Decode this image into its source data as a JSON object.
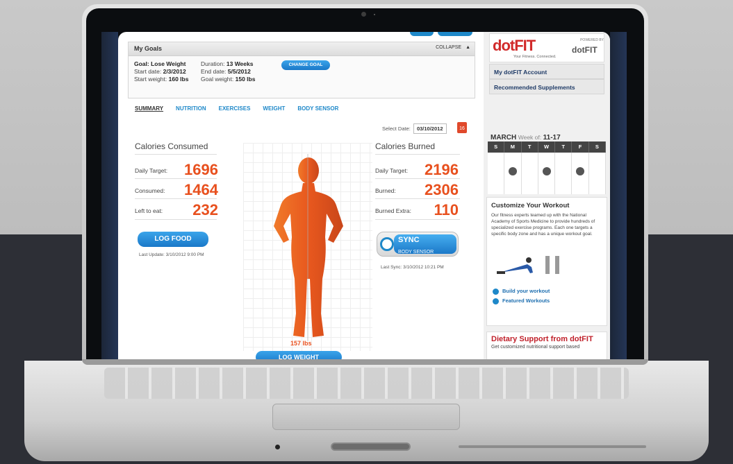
{
  "goals": {
    "title": "My Goals",
    "collapse": "COLLAPSE",
    "goal": "Goal: Lose Weight",
    "start_date_label": "Start date:",
    "start_date": "2/3/2012",
    "start_weight_label": "Start weight:",
    "start_weight": "160 lbs",
    "duration_label": "Duration:",
    "duration": "13 Weeks",
    "end_date_label": "End date:",
    "end_date": "5/5/2012",
    "goal_weight_label": "Goal weight:",
    "goal_weight": "150 lbs",
    "change_goal": "CHANGE GOAL"
  },
  "tabs": [
    "SUMMARY",
    "NUTRITION",
    "EXERCISES",
    "WEIGHT",
    "BODY SENSOR"
  ],
  "date_select": {
    "label": "Select Date:",
    "value": "03/10/2012",
    "icon": "calendar-icon"
  },
  "consumed": {
    "title": "Calories Consumed",
    "daily_target_label": "Daily Target:",
    "daily_target": "1696",
    "consumed_label": "Consumed:",
    "consumed": "1464",
    "left_label": "Left to eat:",
    "left": "232",
    "button": "LOG FOOD",
    "last_update": "Last Update: 3/10/2012 9:00 PM"
  },
  "burned": {
    "title": "Calories Burned",
    "daily_target_label": "Daily Target:",
    "daily_target": "2196",
    "burned_label": "Burned:",
    "burned": "2306",
    "extra_label": "Burned Extra:",
    "extra": "110",
    "sync_title": "SYNC",
    "sync_sub": "BODY SENSOR",
    "last_sync": "Last Sync: 3/10/2012 10:21 PM"
  },
  "body": {
    "weight": "157 lbs",
    "button": "LOG WEIGHT"
  },
  "side": {
    "logo_main": "dotFIT",
    "logo_tag": "Your Fitness. Connected.",
    "powered": "POWERED BY",
    "logo_small": "dotFIT",
    "links": [
      "My dotFIT Account",
      "Recommended Supplements"
    ],
    "month": "MARCH",
    "week_label": "Week of:",
    "week": "11-17",
    "days": [
      "S",
      "M",
      "T",
      "W",
      "T",
      "F",
      "S"
    ],
    "customize_title": "Customize Your Workout",
    "customize_text": "Our fitness experts teamed up with the National Academy of Sports Medicine to provide hundreds of specialized exercise programs. Each one targets a specific body zone and has a unique workout goal.",
    "build": "Build your workout",
    "featured": "Featured Workouts",
    "dietary_title": "Dietary Support from dotFIT",
    "dietary_text": "Get customized nutritional support based"
  },
  "colors": {
    "accent": "#1e88c9",
    "orange": "#e8501e",
    "red": "#c0202a"
  }
}
